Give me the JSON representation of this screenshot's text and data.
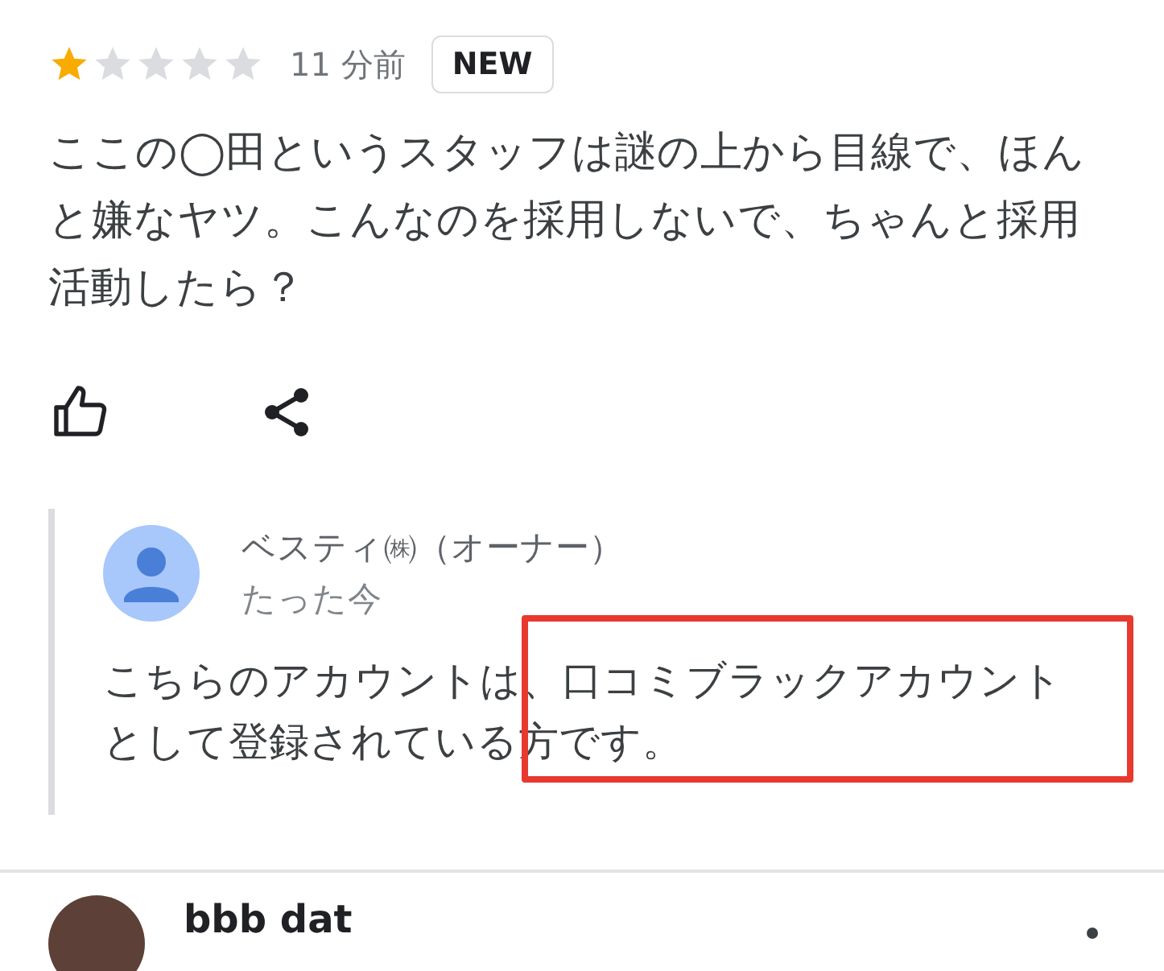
{
  "review": {
    "stars": 1,
    "time": "11 分前",
    "badge": "NEW",
    "text": "ここの◯田というスタッフは謎の上から目線で、ほんと嫌なヤツ。こんなのを採用しないで、ちゃんと採用活動したら？",
    "reply": {
      "author": "ベスティ㈱（オーナー）",
      "time": "たった今",
      "text": "こちらのアカウントは、口コミブラックアカウントとして登録されている方です。",
      "marked": true
    }
  },
  "next_review": {
    "author": "bbb dat"
  }
}
